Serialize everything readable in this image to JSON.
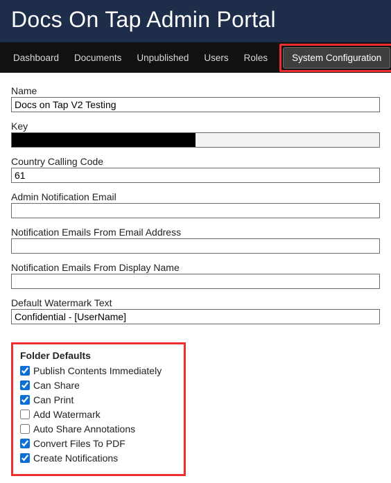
{
  "header": {
    "title": "Docs On Tap Admin Portal"
  },
  "navbar": {
    "items": [
      {
        "label": "Dashboard"
      },
      {
        "label": "Documents"
      },
      {
        "label": "Unpublished"
      },
      {
        "label": "Users"
      },
      {
        "label": "Roles"
      }
    ],
    "active": "System Configuration"
  },
  "form": {
    "name": {
      "label": "Name",
      "value": "Docs on Tap V2 Testing"
    },
    "key": {
      "label": "Key"
    },
    "country_calling_code": {
      "label": "Country Calling Code",
      "value": "61"
    },
    "admin_notification_email": {
      "label": "Admin Notification Email",
      "value": ""
    },
    "notification_from_email": {
      "label": "Notification Emails From Email Address",
      "value": ""
    },
    "notification_from_display": {
      "label": "Notification Emails From Display Name",
      "value": ""
    },
    "default_watermark": {
      "label": "Default Watermark Text",
      "value": "Confidential - [UserName]"
    }
  },
  "folder_defaults": {
    "title": "Folder Defaults",
    "options": [
      {
        "label": "Publish Contents Immediately",
        "checked": true
      },
      {
        "label": "Can Share",
        "checked": true
      },
      {
        "label": "Can Print",
        "checked": true
      },
      {
        "label": "Add Watermark",
        "checked": false
      },
      {
        "label": "Auto Share Annotations",
        "checked": false
      },
      {
        "label": "Convert Files To PDF",
        "checked": true
      },
      {
        "label": "Create Notifications",
        "checked": true
      }
    ]
  }
}
